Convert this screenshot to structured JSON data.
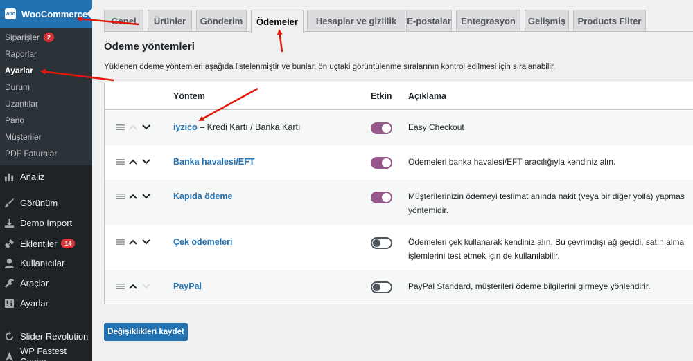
{
  "sidebar": {
    "logo_text": "woo",
    "woocommerce": "WooCommerce",
    "submenu": [
      {
        "label": "Siparişler",
        "badge": "2"
      },
      {
        "label": "Raporlar"
      },
      {
        "label": "Ayarlar"
      },
      {
        "label": "Durum"
      },
      {
        "label": "Uzantılar"
      },
      {
        "label": "Pano"
      },
      {
        "label": "Müşteriler"
      },
      {
        "label": "PDF Faturalar"
      }
    ],
    "menu": [
      {
        "label": "Analiz",
        "icon": "bar-chart-icon"
      },
      {
        "label": "Görünüm",
        "icon": "paintbrush-icon"
      },
      {
        "label": "Demo Import",
        "icon": "download-icon"
      },
      {
        "label": "Eklentiler",
        "icon": "plugin-icon",
        "badge": "14"
      },
      {
        "label": "Kullanıcılar",
        "icon": "user-icon"
      },
      {
        "label": "Araçlar",
        "icon": "wrench-icon"
      },
      {
        "label": "Ayarlar",
        "icon": "settings-icon"
      },
      {
        "label": "Slider Revolution",
        "icon": "refresh-icon"
      },
      {
        "label": "WP Fastest Cache",
        "icon": "cache-icon"
      }
    ]
  },
  "tabs": [
    "Genel",
    "Ürünler",
    "Gönderim",
    "Ödemeler",
    "Hesaplar ve gizlilik",
    "E-postalar",
    "Entegrasyon",
    "Gelişmiş",
    "Products Filter"
  ],
  "active_tab": "Ödemeler",
  "section": {
    "title": "Ödeme yöntemleri",
    "description": "Yüklenen ödeme yöntemleri aşağıda listelenmiştir ve bunlar, ön uçtaki görüntülenme sıralarının kontrol edilmesi için sıralanabilir."
  },
  "table": {
    "headers": {
      "method": "Yöntem",
      "enabled": "Etkin",
      "description": "Açıklama"
    },
    "rows": [
      {
        "name": "iyzico",
        "suffix": " – Kredi Kartı / Banka Kartı",
        "enabled": true,
        "desc1": "Easy Checkout",
        "desc2": ""
      },
      {
        "name": "Banka havalesi/EFT",
        "suffix": "",
        "enabled": true,
        "desc1": "Ödemeleri banka havalesi/EFT aracılığıyla kendiniz alın.",
        "desc2": ""
      },
      {
        "name": "Kapıda ödeme",
        "suffix": "",
        "enabled": true,
        "desc1": "Müşterilerinizin ödemeyi teslimat anında nakit (veya bir diğer yolla) yapmas",
        "desc2": "yöntemidir."
      },
      {
        "name": "Çek ödemeleri",
        "suffix": "",
        "enabled": false,
        "desc1": "Ödemeleri çek kullanarak kendiniz alın. Bu çevrimdışı ağ geçidi, satın alma",
        "desc2": "işlemlerini test etmek için de kullanılabilir."
      },
      {
        "name": "PayPal",
        "suffix": "",
        "enabled": false,
        "desc1": "PayPal Standard, müşterileri ödeme bilgilerini girmeye yönlendirir.",
        "desc2": ""
      }
    ]
  },
  "save_button": "Değişiklikleri kaydet",
  "colors": {
    "accent": "#2271b1",
    "toggle_on": "#96588a",
    "annotation_arrow": "#e3170a",
    "sidebar_bg": "#1d2327"
  }
}
